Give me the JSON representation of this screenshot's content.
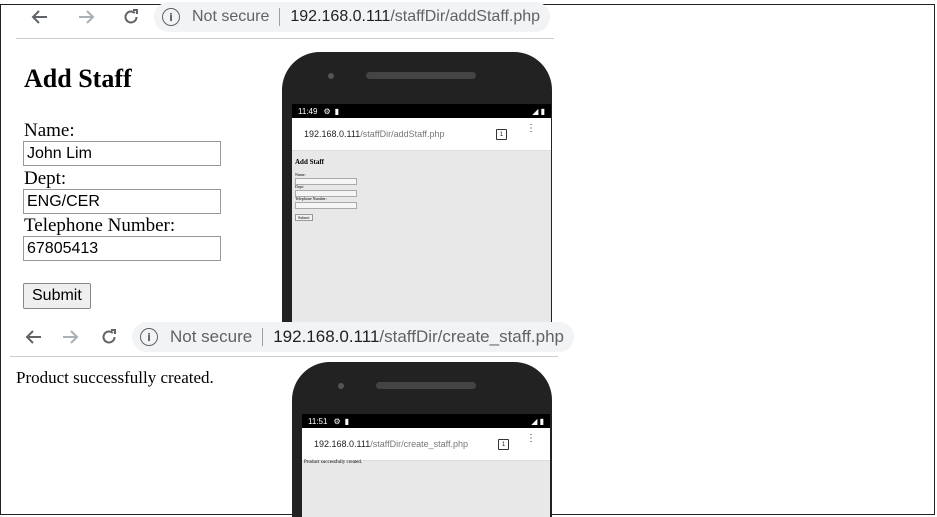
{
  "top": {
    "browser": {
      "back_icon": "arrow-left-icon",
      "forward_icon": "arrow-right-icon",
      "reload_icon": "reload-icon",
      "security_label": "Not secure",
      "url_host": "192.168.0.111",
      "url_path": "/staffDir/addStaff.php"
    },
    "form": {
      "title": "Add Staff",
      "name_label": "Name:",
      "name_value": "John Lim",
      "dept_label": "Dept:",
      "dept_value": "ENG/CER",
      "phone_label": "Telephone Number:",
      "phone_value": "67805413",
      "submit_label": "Submit"
    },
    "mobile": {
      "time": "11:49",
      "url_host": "192.168.0.111",
      "url_path": "/staffDir/addStaff.php",
      "tab_count": "1",
      "title": "Add Staff",
      "name_label": "Name:",
      "dept_label": "Dept:",
      "phone_label": "Telephone Number:",
      "submit_label": "Submit"
    }
  },
  "bottom": {
    "browser": {
      "security_label": "Not secure",
      "url_host": "192.168.0.111",
      "url_path": "/staffDir/create_staff.php"
    },
    "message": "Product successfully created.",
    "mobile": {
      "time": "11:51",
      "url_host": "192.168.0.111",
      "url_path": "/staffDir/create_staff.php",
      "tab_count": "1",
      "message": "Product successfully created."
    }
  }
}
